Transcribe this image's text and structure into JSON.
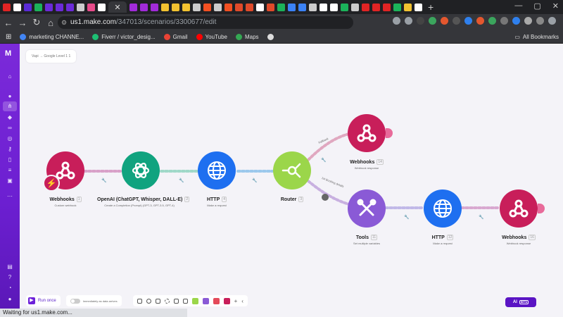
{
  "browser": {
    "url_host": "us1.make.com",
    "url_path": "/347013/scenarios/3300677/edit",
    "bookmarks": [
      "marketing CHANNE...",
      "Fiverr / victor_desig...",
      "Gmail",
      "YouTube",
      "Maps"
    ],
    "all_bookmarks": "All Bookmarks",
    "status_text": "Waiting for us1.make.com..."
  },
  "app": {
    "logo": "M",
    "breadcrumb": "Vapi → Google Level 1 1",
    "nodes": [
      {
        "id": "webhooks1",
        "label": "Webhooks",
        "badge": "1",
        "sub": "Custom webhook"
      },
      {
        "id": "openai",
        "label": "OpenAI (ChatGPT, Whisper, DALL-E)",
        "badge": "2",
        "sub": "Create a Completion (Prompt) (GPT-3, GPT-3.5, GPT-4)"
      },
      {
        "id": "http1",
        "label": "HTTP",
        "badge": "4",
        "sub": "Make a request"
      },
      {
        "id": "router",
        "label": "Router",
        "badge": "3",
        "sub": ""
      },
      {
        "id": "webhooks2",
        "label": "Webhooks",
        "badge": "14",
        "sub": "Webhook response"
      },
      {
        "id": "tools",
        "label": "Tools",
        "badge": "11",
        "sub": "Set multiple variables"
      },
      {
        "id": "http2",
        "label": "HTTP",
        "badge": "12",
        "sub": "Make a request"
      },
      {
        "id": "webhooks3",
        "label": "Webhooks",
        "badge": "16",
        "sub": "Webhook response"
      }
    ],
    "routes": [
      "Fallback",
      "1st Booking details"
    ],
    "bottom": {
      "run_once": "Run once",
      "immediate": "Immediately as data arrives"
    },
    "ai_button": {
      "label": "AI",
      "beta": "BETA"
    }
  },
  "colors": {
    "webhooks": "#c81e5a",
    "openai": "#10a37f",
    "http": "#1e6ff0",
    "router": "#9bd64a",
    "tools": "#8a5ad6",
    "sidebar": "#6c1fd1"
  }
}
